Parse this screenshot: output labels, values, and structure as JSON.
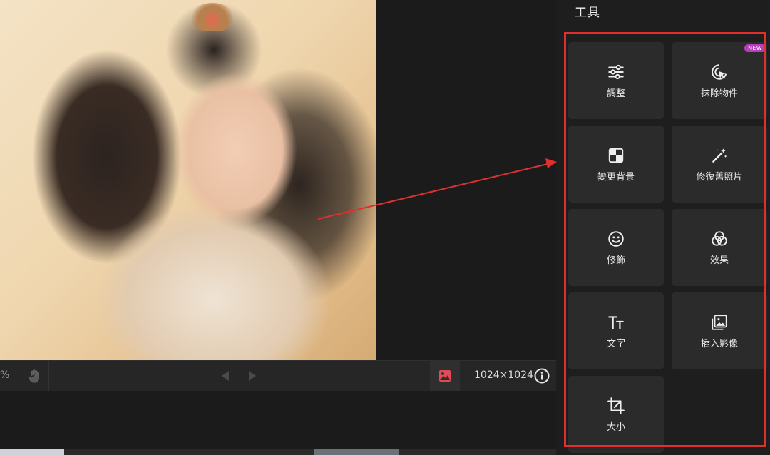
{
  "canvas": {
    "zoom_suffix": "%",
    "dimensions": "1024×1024"
  },
  "panel": {
    "title": "工具",
    "tools": [
      {
        "label": "調整",
        "icon": "sliders-icon"
      },
      {
        "label": "抹除物件",
        "icon": "cursor-click-icon",
        "badge": "NEW"
      },
      {
        "label": "變更背景",
        "icon": "checker-icon"
      },
      {
        "label": "修復舊照片",
        "icon": "magic-wand-icon"
      },
      {
        "label": "修飾",
        "icon": "smiley-icon"
      },
      {
        "label": "效果",
        "icon": "overlap-circles-icon"
      },
      {
        "label": "文字",
        "icon": "text-icon"
      },
      {
        "label": "插入影像",
        "icon": "image-insert-icon"
      },
      {
        "label": "大小",
        "icon": "crop-icon"
      }
    ]
  },
  "colors": {
    "highlight": "#e0302e",
    "badge": "#b43fb9",
    "image_button_accent": "#e24a55"
  }
}
